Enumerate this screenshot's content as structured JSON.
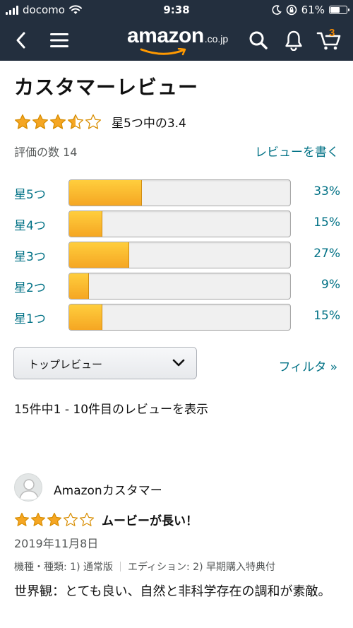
{
  "status_bar": {
    "carrier": "docomo",
    "time": "9:38",
    "battery": "61%",
    "battery_level": 0.61
  },
  "nav": {
    "back_icon": "chevron-left-icon",
    "menu_icon": "hamburger-menu-icon",
    "logo_text": "amazon",
    "logo_tld": ".co.jp",
    "search_icon": "search-icon",
    "notifications_icon": "bell-icon",
    "cart_icon": "cart-icon",
    "cart_count": "3"
  },
  "page": {
    "title": "カスタマーレビュー",
    "rating_value": 3.4,
    "rating_text": "星5つ中の3.4",
    "review_count_label": "評価の数 14",
    "write_review": "レビューを書く"
  },
  "histogram": [
    {
      "label": "星5つ",
      "percent": 33,
      "percent_text": "33%"
    },
    {
      "label": "星4つ",
      "percent": 15,
      "percent_text": "15%"
    },
    {
      "label": "星3つ",
      "percent": 27,
      "percent_text": "27%"
    },
    {
      "label": "星2つ",
      "percent": 9,
      "percent_text": "9%"
    },
    {
      "label": "星1つ",
      "percent": 15,
      "percent_text": "15%"
    }
  ],
  "controls": {
    "sort_selected": "トップレビュー",
    "filter": "フィルタ »"
  },
  "showing_text": "15件中1 - 10件目のレビューを表示",
  "review": {
    "reviewer": "Amazonカスタマー",
    "rating": 3,
    "title": "ムービーが長い！",
    "date": "2019年11月8日",
    "meta_format": "機種・種類: 1) 通常版",
    "meta_edition": "エディション: 2) 早期購入特典付",
    "body": "世界観：とても良い、自然と非科学存在の調和が素敵。"
  },
  "colors": {
    "header_bg": "#232f3e",
    "link": "#007185",
    "star": "#f5a623",
    "bar_fill": "#f5a623",
    "cart_count": "#f08804"
  }
}
